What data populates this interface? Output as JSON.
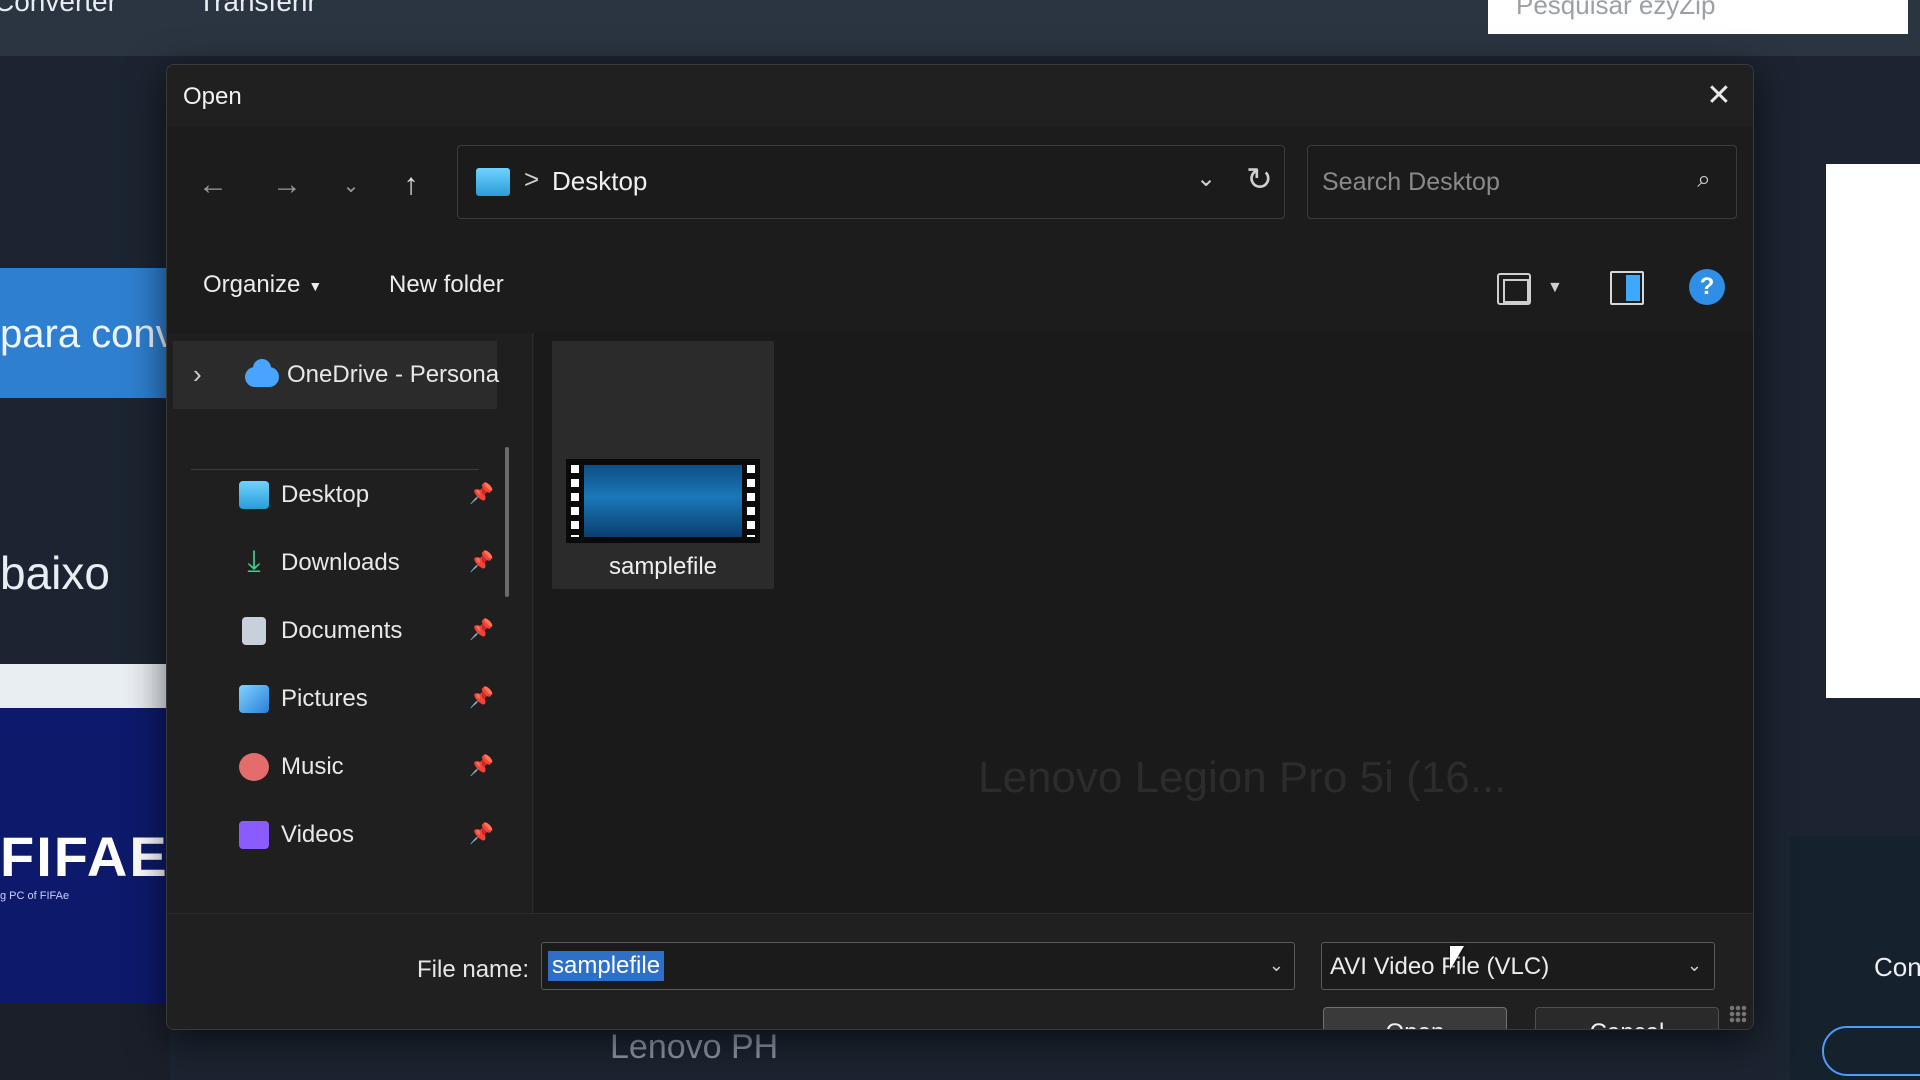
{
  "background": {
    "nav_converter": "Converter",
    "nav_transfer": "Transferir",
    "search_placeholder": "Pesquisar ezyZip",
    "left_blue_text": "para conv",
    "left_text": "baixo",
    "laptop_logo": "FIFAE",
    "laptop_tagline": "g PC of FIFAe",
    "ghost_product": "Lenovo Legion Pro 5i (16...",
    "bottom_brand": "Lenovo PH",
    "right_button_text": "Con"
  },
  "dialog": {
    "title": "Open",
    "nav": {
      "back_icon": "arrow-left-icon",
      "forward_icon": "arrow-right-icon",
      "recent_icon": "chevron-down-icon",
      "up_icon": "arrow-up-icon"
    },
    "address": {
      "separator": ">",
      "location": "Desktop"
    },
    "search": {
      "placeholder": "Search Desktop"
    },
    "toolbar": {
      "organize_label": "Organize",
      "new_folder_label": "New folder",
      "help_label": "?"
    },
    "sidebar": {
      "onedrive_label": "OneDrive - Persona",
      "items": [
        {
          "label": "Desktop",
          "icon": "desktop-icon"
        },
        {
          "label": "Downloads",
          "icon": "download-icon"
        },
        {
          "label": "Documents",
          "icon": "document-icon"
        },
        {
          "label": "Pictures",
          "icon": "pictures-icon"
        },
        {
          "label": "Music",
          "icon": "music-icon"
        },
        {
          "label": "Videos",
          "icon": "videos-icon"
        }
      ]
    },
    "files": [
      {
        "name": "samplefile",
        "type": "video"
      }
    ],
    "file_name_label": "File name:",
    "file_name_value": "samplefile",
    "file_type_value": "AVI Video File (VLC)",
    "open_label": "Open",
    "cancel_label": "Cancel"
  }
}
